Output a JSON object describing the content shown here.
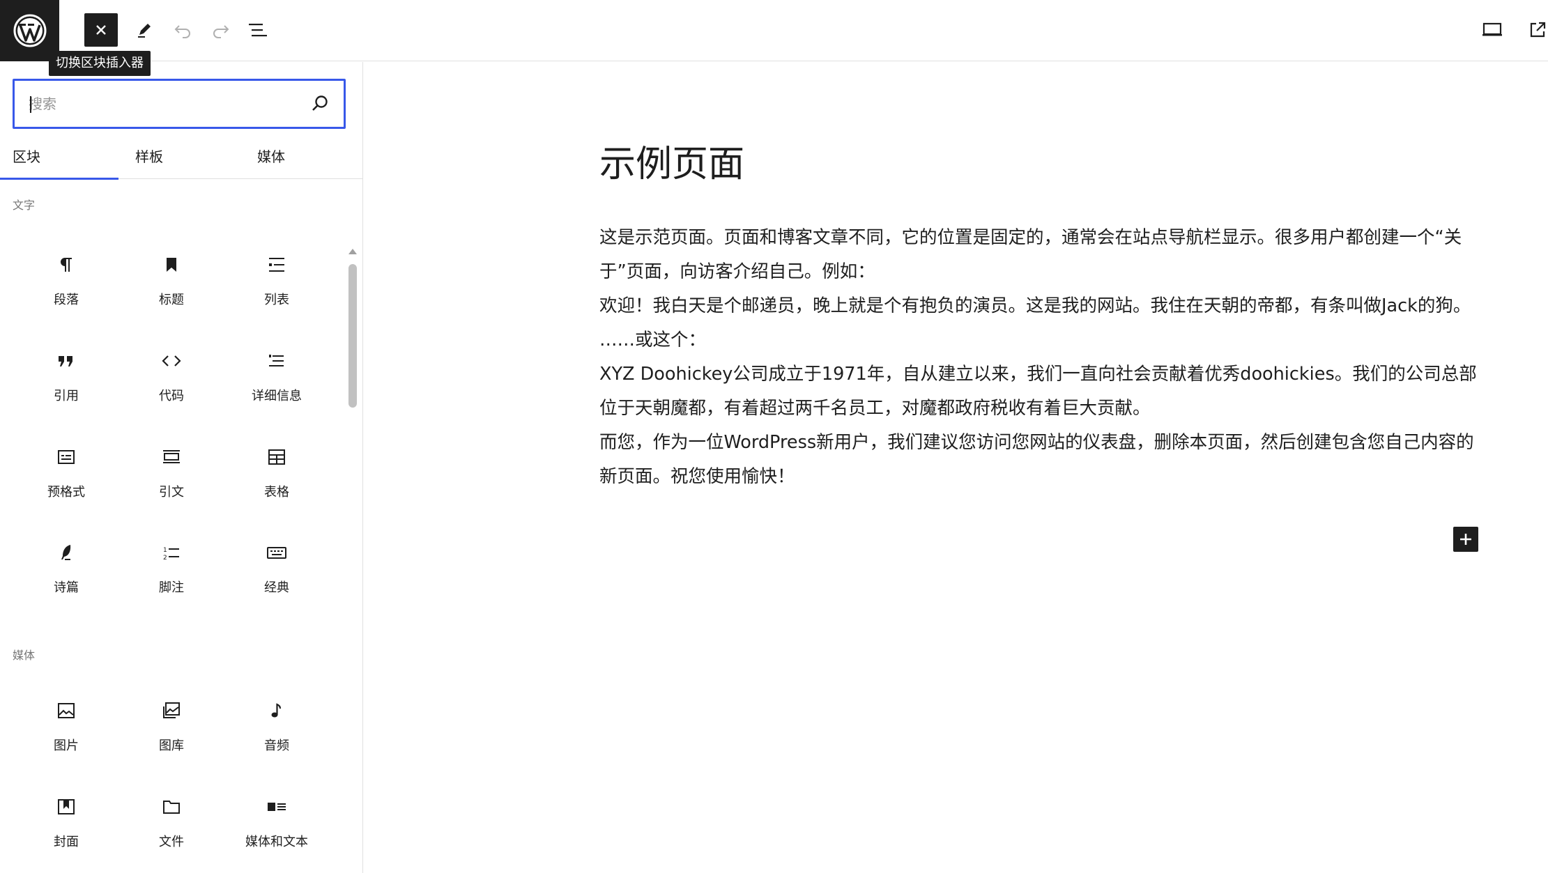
{
  "toolbar": {
    "tooltip": "切换区块插入器"
  },
  "inserter": {
    "search_placeholder": "搜索",
    "tabs": [
      {
        "label": "区块"
      },
      {
        "label": "样板"
      },
      {
        "label": "媒体"
      }
    ],
    "categories": [
      {
        "title": "文字",
        "items": [
          {
            "label": "段落",
            "icon": "paragraph-icon"
          },
          {
            "label": "标题",
            "icon": "heading-icon"
          },
          {
            "label": "列表",
            "icon": "list-icon"
          },
          {
            "label": "引用",
            "icon": "quote-icon"
          },
          {
            "label": "代码",
            "icon": "code-icon"
          },
          {
            "label": "详细信息",
            "icon": "details-icon"
          },
          {
            "label": "预格式",
            "icon": "preformatted-icon"
          },
          {
            "label": "引文",
            "icon": "pullquote-icon"
          },
          {
            "label": "表格",
            "icon": "table-icon"
          },
          {
            "label": "诗篇",
            "icon": "verse-icon"
          },
          {
            "label": "脚注",
            "icon": "footnotes-icon"
          },
          {
            "label": "经典",
            "icon": "classic-icon"
          }
        ]
      },
      {
        "title": "媒体",
        "items": [
          {
            "label": "图片",
            "icon": "image-icon"
          },
          {
            "label": "图库",
            "icon": "gallery-icon"
          },
          {
            "label": "音频",
            "icon": "audio-icon"
          },
          {
            "label": "封面",
            "icon": "cover-icon"
          },
          {
            "label": "文件",
            "icon": "file-icon"
          },
          {
            "label": "媒体和文本",
            "icon": "media-text-icon"
          }
        ]
      }
    ]
  },
  "editor": {
    "title": "示例页面",
    "paragraphs": [
      "这是示范页面。页面和博客文章不同，它的位置是固定的，通常会在站点导航栏显示。很多用户都创建一个“关于”页面，向访客介绍自己。例如：",
      "欢迎！我白天是个邮递员，晚上就是个有抱负的演员。这是我的网站。我住在天朝的帝都，有条叫做Jack的狗。",
      "……或这个：",
      "XYZ Doohickey公司成立于1971年，自从建立以来，我们一直向社会贡献着优秀doohickies。我们的公司总部位于天朝魔都，有着超过两千名员工，对魔都政府税收有着巨大贡献。"
    ],
    "last_paragraph": {
      "before": "而您，作为一位WordPress新用户，我们建议您访问",
      "link": "您网站的仪表盘",
      "after": "，删除本页面，然后创建包含您自己内容的新页面。祝您使用愉快！"
    }
  }
}
